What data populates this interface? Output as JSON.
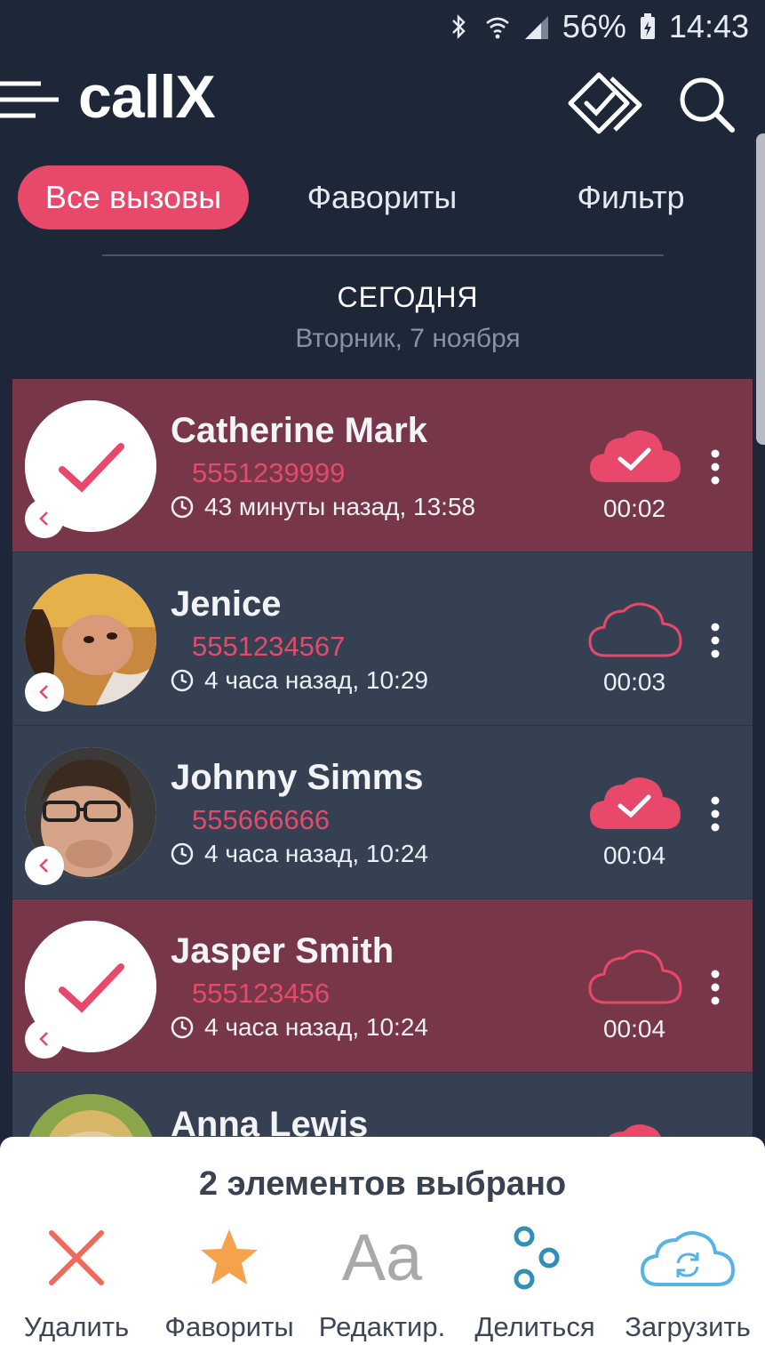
{
  "status_bar": {
    "battery": "56%",
    "time": "14:43"
  },
  "app": {
    "title": "callX"
  },
  "tabs": [
    {
      "label": "Все вызовы",
      "active": true
    },
    {
      "label": "Фавориты",
      "active": false
    },
    {
      "label": "Фильтр",
      "active": false
    }
  ],
  "date_header": {
    "title": "СЕГОДНЯ",
    "subtitle": "Вторник, 7 ноября"
  },
  "calls": [
    {
      "name": "Catherine Mark",
      "number": "5551239999",
      "time": "43 минуты назад, 13:58",
      "duration": "00:02",
      "selected": true,
      "cloud_uploaded": true
    },
    {
      "name": "Jenice",
      "number": "5551234567",
      "time": "4 часа назад, 10:29",
      "duration": "00:03",
      "selected": false,
      "cloud_uploaded": false
    },
    {
      "name": "Johnny Simms",
      "number": "555666666",
      "time": "4 часа назад, 10:24",
      "duration": "00:04",
      "selected": false,
      "cloud_uploaded": true
    },
    {
      "name": "Jasper Smith",
      "number": "555123456",
      "time": "4 часа назад, 10:24",
      "duration": "00:04",
      "selected": true,
      "cloud_uploaded": false
    },
    {
      "name": "Anna Lewis",
      "selected": false,
      "cloud_uploaded": true
    }
  ],
  "action_panel": {
    "title": "2 элементов выбрано",
    "actions": [
      {
        "label": "Удалить",
        "icon": "close-icon",
        "color": "#ef6a5a"
      },
      {
        "label": "Фавориты",
        "icon": "star-icon",
        "color": "#f6a24a"
      },
      {
        "label": "Редактир.",
        "icon": "text-edit-icon",
        "glyph": "Aa",
        "color": "#a9a9a9"
      },
      {
        "label": "Делиться",
        "icon": "share-icon",
        "color": "#2f8fb8"
      },
      {
        "label": "Загрузить",
        "icon": "cloud-sync-icon",
        "color": "#56b3e3"
      }
    ]
  },
  "colors": {
    "accent": "#e8496a",
    "background": "#1e2738",
    "row": "#354052",
    "row_selected": "#773749"
  }
}
